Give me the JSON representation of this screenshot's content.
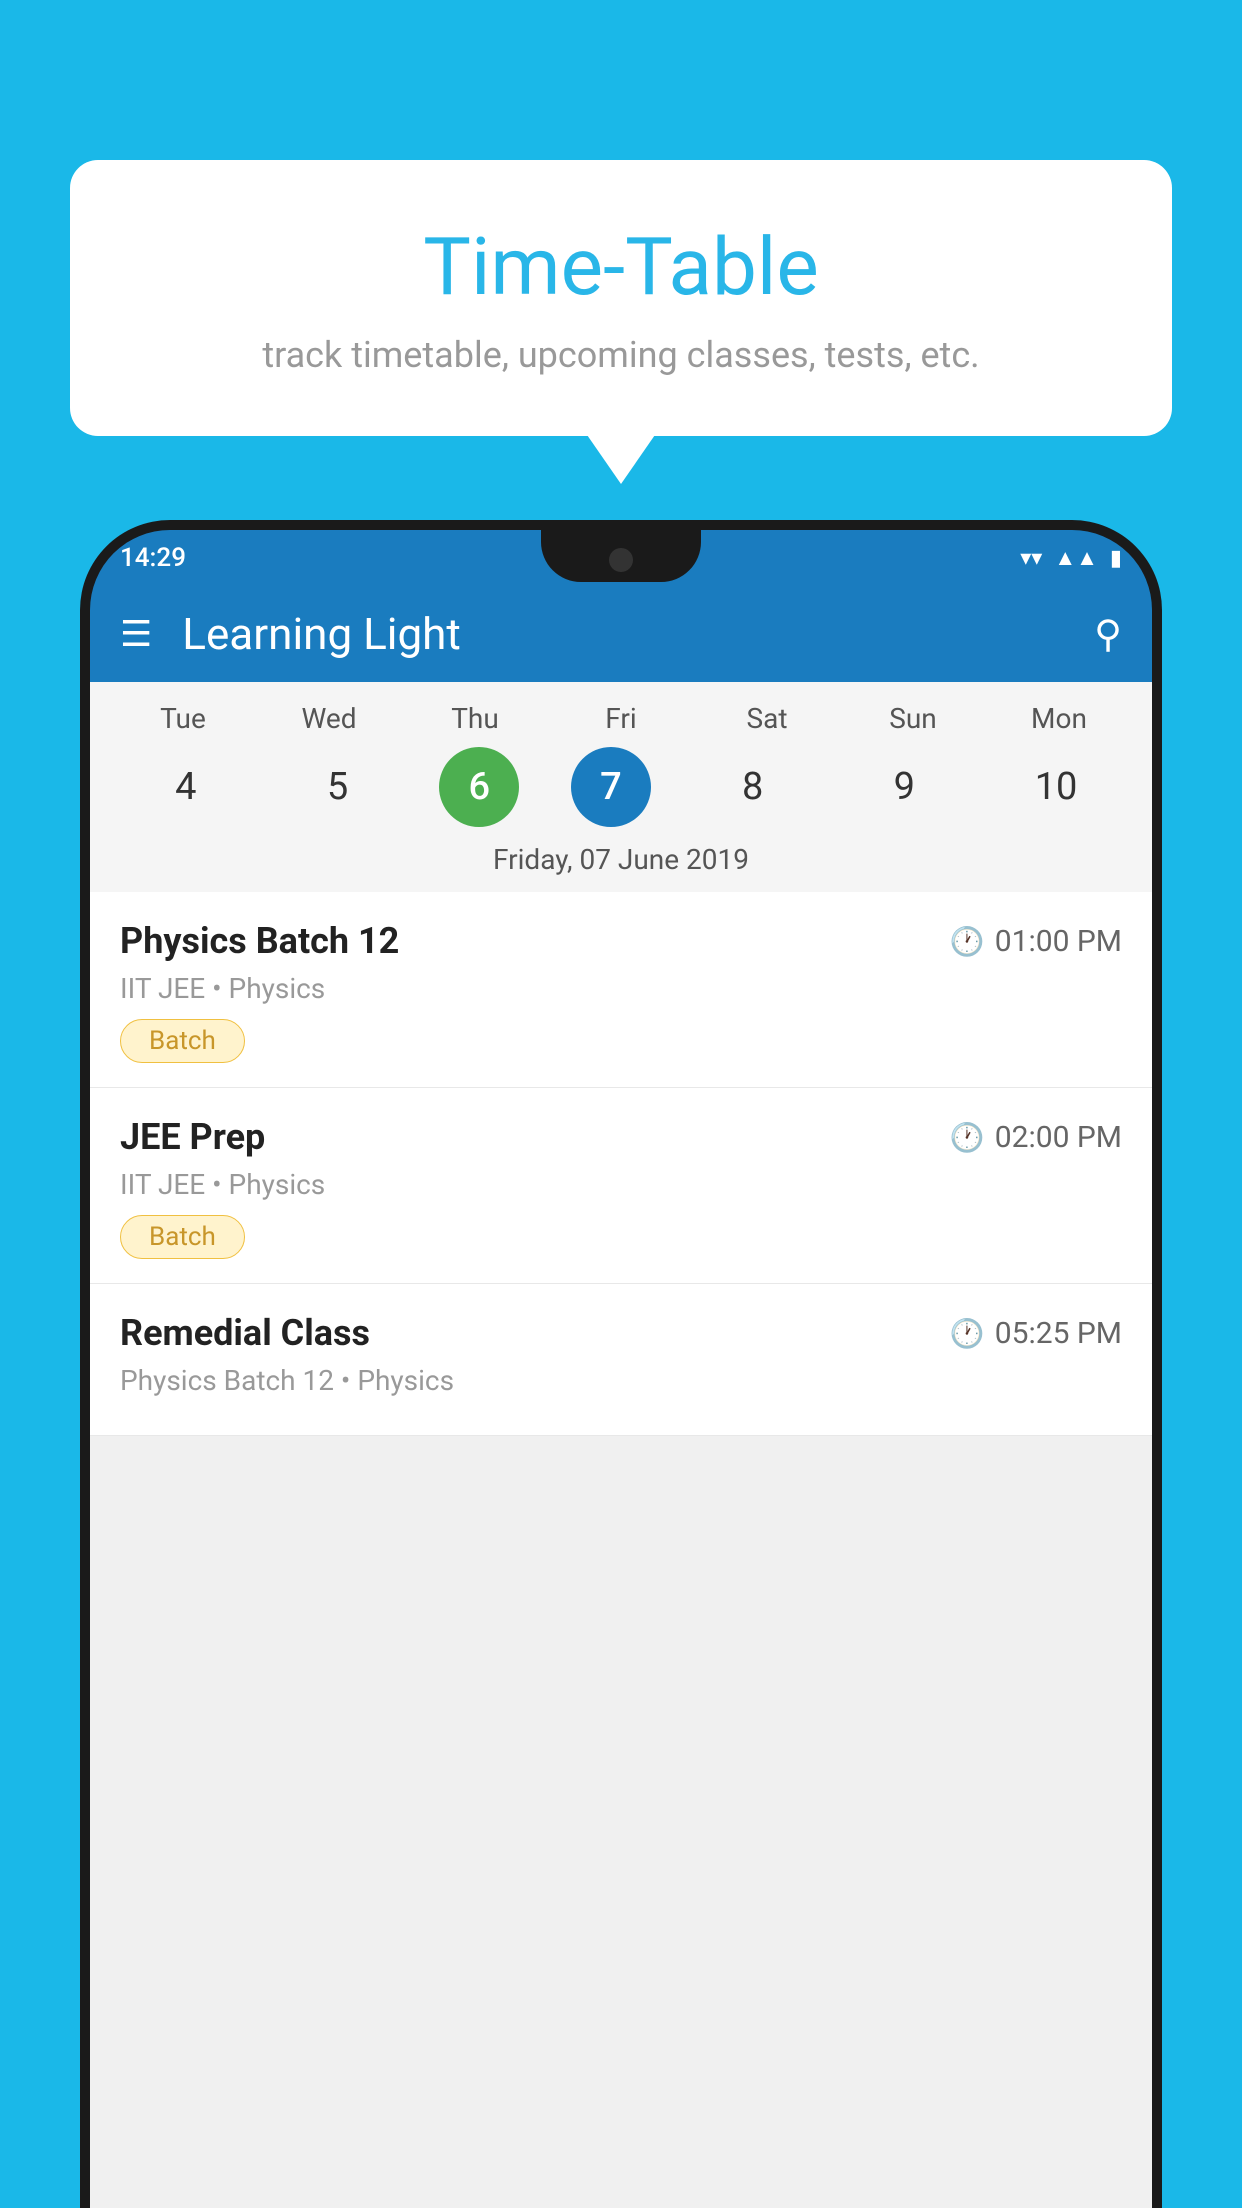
{
  "background_color": "#1ab8e8",
  "speech_bubble": {
    "title": "Time-Table",
    "subtitle": "track timetable, upcoming classes, tests, etc."
  },
  "status_bar": {
    "time": "14:29"
  },
  "app_bar": {
    "title": "Learning Light"
  },
  "calendar": {
    "days": [
      {
        "name": "Tue",
        "number": "4",
        "state": "normal"
      },
      {
        "name": "Wed",
        "number": "5",
        "state": "normal"
      },
      {
        "name": "Thu",
        "number": "6",
        "state": "today"
      },
      {
        "name": "Fri",
        "number": "7",
        "state": "selected"
      },
      {
        "name": "Sat",
        "number": "8",
        "state": "normal"
      },
      {
        "name": "Sun",
        "number": "9",
        "state": "normal"
      },
      {
        "name": "Mon",
        "number": "10",
        "state": "normal"
      }
    ],
    "selected_date": "Friday, 07 June 2019"
  },
  "classes": [
    {
      "name": "Physics Batch 12",
      "time": "01:00 PM",
      "meta": "IIT JEE • Physics",
      "badge": "Batch"
    },
    {
      "name": "JEE Prep",
      "time": "02:00 PM",
      "meta": "IIT JEE • Physics",
      "badge": "Batch"
    },
    {
      "name": "Remedial Class",
      "time": "05:25 PM",
      "meta": "Physics Batch 12 • Physics",
      "badge": null
    }
  ]
}
